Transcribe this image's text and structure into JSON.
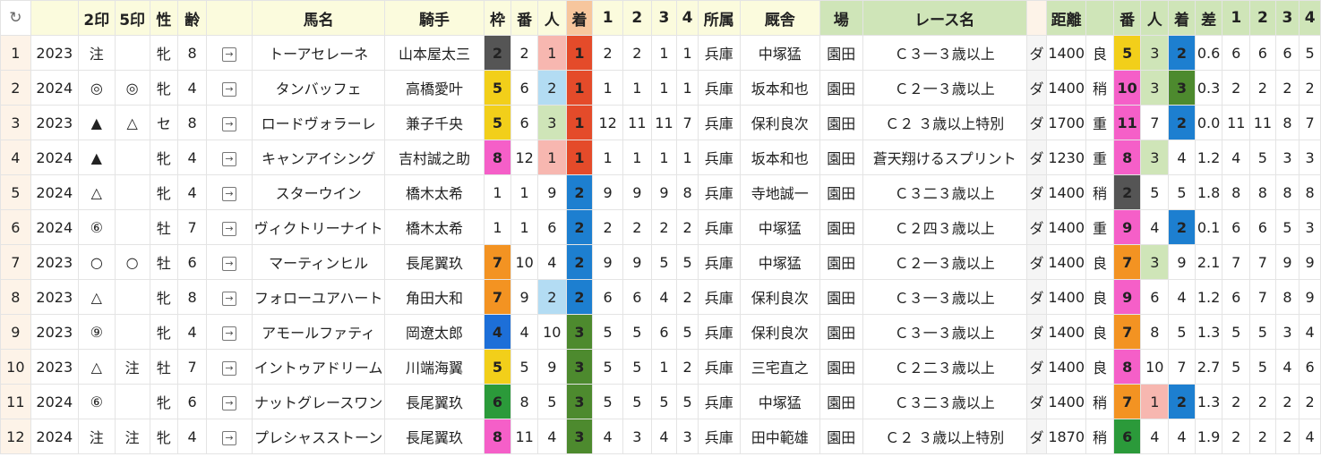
{
  "headers": {
    "refresh": "↻",
    "year": "",
    "m2": "2印",
    "m5": "5印",
    "sex": "性",
    "age": "齢",
    "link": "",
    "name": "馬名",
    "jockey": "騎手",
    "waku": "枠",
    "num": "番",
    "pop": "人",
    "finish": "着",
    "c1": "1",
    "c2": "2",
    "c3": "3",
    "c4": "4",
    "stable": "所属",
    "trainer": "厩舎",
    "venue": "場",
    "race": "レース名",
    "blank": "",
    "dist": "距離",
    "cond": "",
    "num2": "番",
    "pop2": "人",
    "fin2": "着",
    "diff": "差",
    "d1": "1",
    "d2": "2",
    "d3": "3",
    "d4": "4"
  },
  "rows": [
    {
      "no": "1",
      "year": "2023",
      "m2": "注",
      "m5": "",
      "sex": "牝",
      "age": "8",
      "name": "トーアセレーネ",
      "jockey": "山本屋太三",
      "waku": "2",
      "num": "2",
      "pop": "1",
      "fin": "1",
      "c1": "2",
      "c2": "2",
      "c3": "1",
      "c4": "1",
      "stable": "兵庫",
      "trainer": "中塚猛",
      "venue": "園田",
      "race": "Ｃ３一３歳以上",
      "surf": "ダ",
      "dist": "1400",
      "cond": "良",
      "num2": "5",
      "pop2": "3",
      "fin2": "2",
      "diff": "0.6",
      "d1": "6",
      "d2": "6",
      "d3": "6",
      "d4": "5"
    },
    {
      "no": "2",
      "year": "2024",
      "m2": "◎",
      "m5": "◎",
      "sex": "牝",
      "age": "4",
      "name": "タンバッフェ",
      "jockey": "高橋愛叶",
      "waku": "5",
      "num": "6",
      "pop": "2",
      "fin": "1",
      "c1": "1",
      "c2": "1",
      "c3": "1",
      "c4": "1",
      "stable": "兵庫",
      "trainer": "坂本和也",
      "venue": "園田",
      "race": "Ｃ２一３歳以上",
      "surf": "ダ",
      "dist": "1400",
      "cond": "稍",
      "num2": "10",
      "pop2": "3",
      "fin2": "3",
      "diff": "0.3",
      "d1": "2",
      "d2": "2",
      "d3": "2",
      "d4": "2"
    },
    {
      "no": "3",
      "year": "2023",
      "m2": "▲",
      "m5": "△",
      "sex": "セ",
      "age": "8",
      "name": "ロードヴォラーレ",
      "jockey": "兼子千央",
      "waku": "5",
      "num": "6",
      "pop": "3",
      "fin": "1",
      "c1": "12",
      "c2": "11",
      "c3": "11",
      "c4": "7",
      "stable": "兵庫",
      "trainer": "保利良次",
      "venue": "園田",
      "race": "Ｃ２ ３歳以上特別",
      "surf": "ダ",
      "dist": "1700",
      "cond": "重",
      "num2": "11",
      "pop2": "7",
      "fin2": "2",
      "diff": "0.0",
      "d1": "11",
      "d2": "11",
      "d3": "8",
      "d4": "7"
    },
    {
      "no": "4",
      "year": "2024",
      "m2": "▲",
      "m5": "",
      "sex": "牝",
      "age": "4",
      "name": "キャンアイシング",
      "jockey": "吉村誠之助",
      "waku": "8",
      "num": "12",
      "pop": "1",
      "fin": "1",
      "c1": "1",
      "c2": "1",
      "c3": "1",
      "c4": "1",
      "stable": "兵庫",
      "trainer": "坂本和也",
      "venue": "園田",
      "race": "蒼天翔けるスプリント",
      "surf": "ダ",
      "dist": "1230",
      "cond": "重",
      "num2": "8",
      "pop2": "3",
      "fin2": "4",
      "diff": "1.2",
      "d1": "4",
      "d2": "5",
      "d3": "3",
      "d4": "3"
    },
    {
      "no": "5",
      "year": "2024",
      "m2": "△",
      "m5": "",
      "sex": "牝",
      "age": "4",
      "name": "スターウイン",
      "jockey": "橋木太希",
      "waku": "1",
      "num": "1",
      "pop": "9",
      "fin": "2",
      "c1": "9",
      "c2": "9",
      "c3": "9",
      "c4": "8",
      "stable": "兵庫",
      "trainer": "寺地誠一",
      "venue": "園田",
      "race": "Ｃ３二３歳以上",
      "surf": "ダ",
      "dist": "1400",
      "cond": "稍",
      "num2": "2",
      "pop2": "5",
      "fin2": "5",
      "diff": "1.8",
      "d1": "8",
      "d2": "8",
      "d3": "8",
      "d4": "8"
    },
    {
      "no": "6",
      "year": "2024",
      "m2": "⑥",
      "m5": "",
      "sex": "牡",
      "age": "7",
      "name": "ヴィクトリーナイト",
      "jockey": "橋木太希",
      "waku": "1",
      "num": "1",
      "pop": "6",
      "fin": "2",
      "c1": "2",
      "c2": "2",
      "c3": "2",
      "c4": "2",
      "stable": "兵庫",
      "trainer": "中塚猛",
      "venue": "園田",
      "race": "Ｃ２四３歳以上",
      "surf": "ダ",
      "dist": "1400",
      "cond": "重",
      "num2": "9",
      "pop2": "4",
      "fin2": "2",
      "diff": "0.1",
      "d1": "6",
      "d2": "6",
      "d3": "5",
      "d4": "3"
    },
    {
      "no": "7",
      "year": "2023",
      "m2": "○",
      "m5": "○",
      "sex": "牡",
      "age": "6",
      "name": "マーティンヒル",
      "jockey": "長尾翼玖",
      "waku": "7",
      "num": "10",
      "pop": "4",
      "fin": "2",
      "c1": "9",
      "c2": "9",
      "c3": "5",
      "c4": "5",
      "stable": "兵庫",
      "trainer": "中塚猛",
      "venue": "園田",
      "race": "Ｃ２一３歳以上",
      "surf": "ダ",
      "dist": "1400",
      "cond": "良",
      "num2": "7",
      "pop2": "3",
      "fin2": "9",
      "diff": "2.1",
      "d1": "7",
      "d2": "7",
      "d3": "9",
      "d4": "9"
    },
    {
      "no": "8",
      "year": "2023",
      "m2": "△",
      "m5": "",
      "sex": "牝",
      "age": "8",
      "name": "フォローユアハート",
      "jockey": "角田大和",
      "waku": "7",
      "num": "9",
      "pop": "2",
      "fin": "2",
      "c1": "6",
      "c2": "6",
      "c3": "4",
      "c4": "2",
      "stable": "兵庫",
      "trainer": "保利良次",
      "venue": "園田",
      "race": "Ｃ３一３歳以上",
      "surf": "ダ",
      "dist": "1400",
      "cond": "良",
      "num2": "9",
      "pop2": "6",
      "fin2": "4",
      "diff": "1.2",
      "d1": "6",
      "d2": "7",
      "d3": "8",
      "d4": "9"
    },
    {
      "no": "9",
      "year": "2023",
      "m2": "⑨",
      "m5": "",
      "sex": "牝",
      "age": "4",
      "name": "アモールファティ",
      "jockey": "岡遼太郎",
      "waku": "4",
      "num": "4",
      "pop": "10",
      "fin": "3",
      "c1": "5",
      "c2": "5",
      "c3": "6",
      "c4": "5",
      "stable": "兵庫",
      "trainer": "保利良次",
      "venue": "園田",
      "race": "Ｃ３一３歳以上",
      "surf": "ダ",
      "dist": "1400",
      "cond": "良",
      "num2": "7",
      "pop2": "8",
      "fin2": "5",
      "diff": "1.3",
      "d1": "5",
      "d2": "5",
      "d3": "3",
      "d4": "4"
    },
    {
      "no": "10",
      "year": "2023",
      "m2": "△",
      "m5": "注",
      "sex": "牡",
      "age": "7",
      "name": "イントゥアドリーム",
      "jockey": "川端海翼",
      "waku": "5",
      "num": "5",
      "pop": "9",
      "fin": "3",
      "c1": "5",
      "c2": "5",
      "c3": "1",
      "c4": "2",
      "stable": "兵庫",
      "trainer": "三宅直之",
      "venue": "園田",
      "race": "Ｃ２二３歳以上",
      "surf": "ダ",
      "dist": "1400",
      "cond": "良",
      "num2": "8",
      "pop2": "10",
      "fin2": "7",
      "diff": "2.7",
      "d1": "5",
      "d2": "5",
      "d3": "4",
      "d4": "6"
    },
    {
      "no": "11",
      "year": "2024",
      "m2": "⑥",
      "m5": "",
      "sex": "牝",
      "age": "6",
      "name": "ナットグレースワン",
      "jockey": "長尾翼玖",
      "waku": "6",
      "num": "8",
      "pop": "5",
      "fin": "3",
      "c1": "5",
      "c2": "5",
      "c3": "5",
      "c4": "5",
      "stable": "兵庫",
      "trainer": "中塚猛",
      "venue": "園田",
      "race": "Ｃ３二３歳以上",
      "surf": "ダ",
      "dist": "1400",
      "cond": "稍",
      "num2": "7",
      "pop2": "1",
      "fin2": "2",
      "diff": "1.3",
      "d1": "2",
      "d2": "2",
      "d3": "2",
      "d4": "2"
    },
    {
      "no": "12",
      "year": "2024",
      "m2": "注",
      "m5": "注",
      "sex": "牝",
      "age": "4",
      "name": "プレシャスストーン",
      "jockey": "長尾翼玖",
      "waku": "8",
      "num": "11",
      "pop": "4",
      "fin": "3",
      "c1": "4",
      "c2": "3",
      "c3": "4",
      "c4": "3",
      "stable": "兵庫",
      "trainer": "田中範雄",
      "venue": "園田",
      "race": "Ｃ２ ３歳以上特別",
      "surf": "ダ",
      "dist": "1870",
      "cond": "稍",
      "num2": "6",
      "pop2": "4",
      "fin2": "4",
      "diff": "1.9",
      "d1": "2",
      "d2": "2",
      "d3": "2",
      "d4": "4"
    }
  ]
}
